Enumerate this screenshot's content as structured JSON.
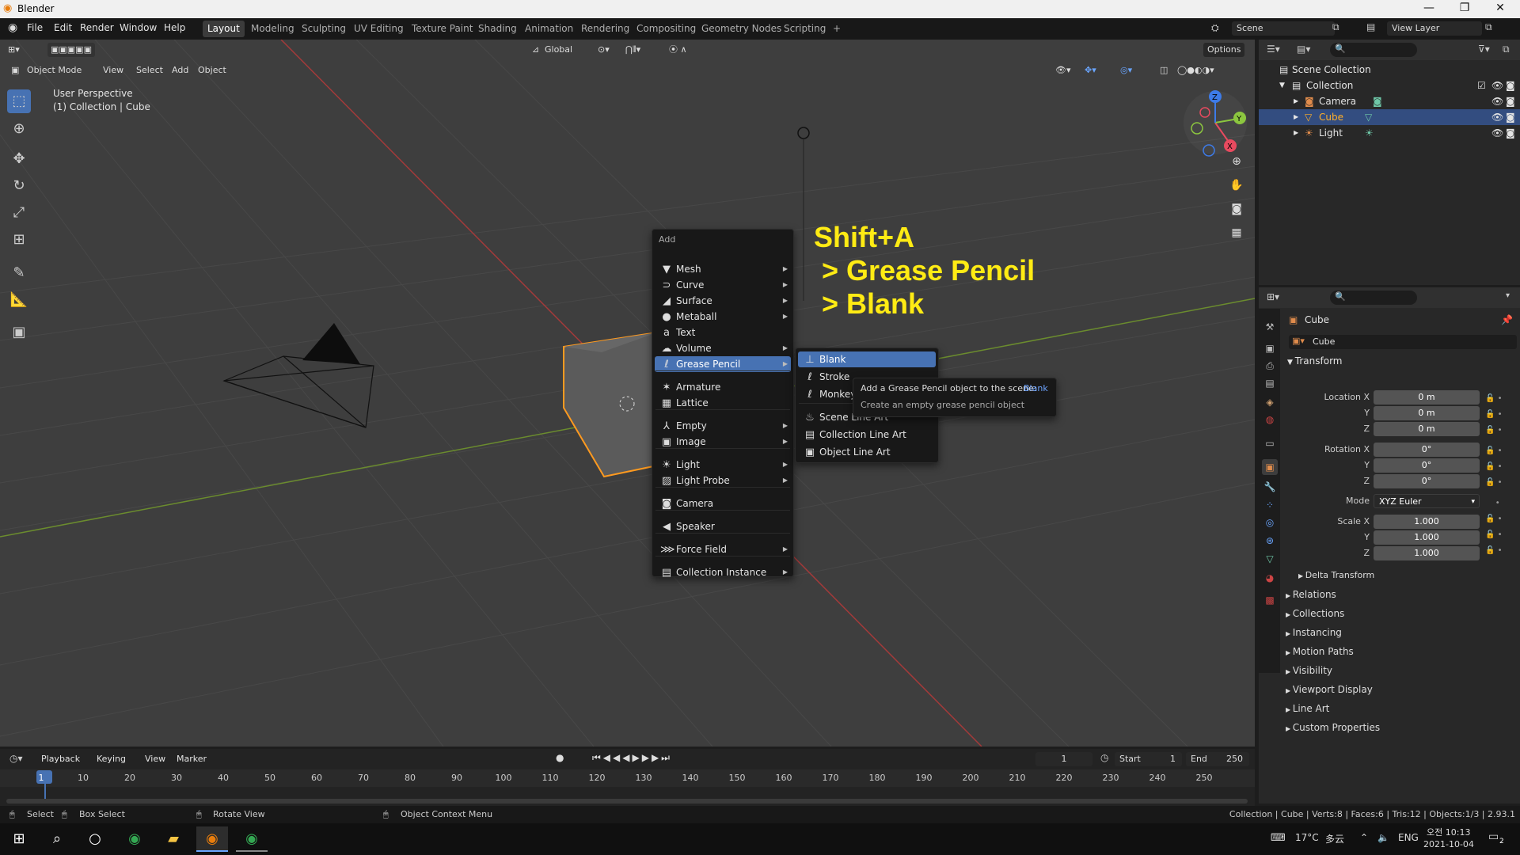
{
  "window": {
    "title": "Blender",
    "minimize": "—",
    "restore": "❐",
    "close": "✕"
  },
  "menubar": [
    "File",
    "Edit",
    "Render",
    "Window",
    "Help"
  ],
  "workspaces": [
    "Layout",
    "Modeling",
    "Sculpting",
    "UV Editing",
    "Texture Paint",
    "Shading",
    "Animation",
    "Rendering",
    "Compositing",
    "Geometry Nodes",
    "Scripting"
  ],
  "workspace_add": "+",
  "scene": {
    "name": "Scene",
    "view_layer": "View Layer"
  },
  "header": {
    "orientation": "Global",
    "options": "Options"
  },
  "viewport_header": {
    "mode": "Object Mode",
    "menus": [
      "View",
      "Select",
      "Add",
      "Object"
    ]
  },
  "viewport": {
    "perspective": "User Perspective",
    "collection": "(1) Collection | Cube"
  },
  "gizmo": {
    "x": "X",
    "y": "Y",
    "z": "Z"
  },
  "annotation": {
    "line1": "Shift+A",
    "line2": "> Grease Pencil",
    "line3": "> Blank"
  },
  "add_menu": {
    "title": "Add",
    "items": [
      {
        "label": "Mesh",
        "icon": "mesh-icon",
        "glyph": "▼",
        "submenu": true
      },
      {
        "label": "Curve",
        "icon": "curve-icon",
        "glyph": "⊃",
        "submenu": true
      },
      {
        "label": "Surface",
        "icon": "surface-icon",
        "glyph": "◢",
        "submenu": true
      },
      {
        "label": "Metaball",
        "icon": "metaball-icon",
        "glyph": "●",
        "submenu": true
      },
      {
        "label": "Text",
        "icon": "text-icon",
        "glyph": "a",
        "submenu": false
      },
      {
        "label": "Volume",
        "icon": "volume-icon",
        "glyph": "☁",
        "submenu": true
      },
      {
        "label": "Grease Pencil",
        "icon": "grease-pencil-icon",
        "glyph": "ℓ",
        "submenu": true,
        "active": true
      },
      {
        "label": "Armature",
        "icon": "armature-icon",
        "glyph": "✶",
        "submenu": false
      },
      {
        "label": "Lattice",
        "icon": "lattice-icon",
        "glyph": "▦",
        "submenu": false
      },
      {
        "label": "Empty",
        "icon": "empty-icon",
        "glyph": "⅄",
        "submenu": true
      },
      {
        "label": "Image",
        "icon": "image-icon",
        "glyph": "▣",
        "submenu": true
      },
      {
        "label": "Light",
        "icon": "light-icon",
        "glyph": "☀",
        "submenu": true
      },
      {
        "label": "Light Probe",
        "icon": "light-probe-icon",
        "glyph": "▨",
        "submenu": true
      },
      {
        "label": "Camera",
        "icon": "camera-icon",
        "glyph": "◙",
        "submenu": false
      },
      {
        "label": "Speaker",
        "icon": "speaker-icon",
        "glyph": "◀",
        "submenu": false
      },
      {
        "label": "Force Field",
        "icon": "force-field-icon",
        "glyph": "⋙",
        "submenu": true
      },
      {
        "label": "Collection Instance",
        "icon": "collection-instance-icon",
        "glyph": "▤",
        "submenu": true
      }
    ]
  },
  "gp_submenu": {
    "items": [
      {
        "label": "Blank",
        "icon": "blank-gp-icon",
        "glyph": "⊥"
      },
      {
        "label": "Stroke",
        "icon": "stroke-icon",
        "glyph": "ℓ"
      },
      {
        "label": "Monkey",
        "icon": "monkey-icon",
        "glyph": "ℓ"
      },
      {
        "label": "Scene Line Art",
        "icon": "scene-line-art-icon",
        "glyph": "♨"
      },
      {
        "label": "Collection Line Art",
        "icon": "collection-line-art-icon",
        "glyph": "▤"
      },
      {
        "label": "Object Line Art",
        "icon": "object-line-art-icon",
        "glyph": "▣"
      }
    ]
  },
  "tooltip": {
    "prefix": "Add a Grease Pencil object to the scene:",
    "highlight": "Blank",
    "description": "Create an empty grease pencil object"
  },
  "outliner": {
    "root": "Scene Collection",
    "collection": "Collection",
    "objects": [
      "Camera",
      "Cube",
      "Light"
    ]
  },
  "properties": {
    "object_name": "Cube",
    "datablock": "Cube",
    "transform_title": "Transform",
    "location_label": "Location X",
    "rotation_label": "Rotation X",
    "scale_label": "Scale X",
    "y": "Y",
    "z": "Z",
    "location": [
      "0 m",
      "0 m",
      "0 m"
    ],
    "rotation": [
      "0°",
      "0°",
      "0°"
    ],
    "mode_label": "Mode",
    "mode": "XYZ Euler",
    "scale": [
      "1.000",
      "1.000",
      "1.000"
    ],
    "delta": "Delta Transform",
    "sections": [
      "Relations",
      "Collections",
      "Instancing",
      "Motion Paths",
      "Visibility",
      "Viewport Display",
      "Line Art",
      "Custom Properties"
    ]
  },
  "timeline": {
    "menus": [
      "Playback",
      "Keying",
      "View",
      "Marker"
    ],
    "current_frame": "1",
    "start_label": "Start",
    "start": "1",
    "end_label": "End",
    "end": "250",
    "ticks": [
      "1",
      "10",
      "20",
      "30",
      "40",
      "50",
      "60",
      "70",
      "80",
      "90",
      "100",
      "110",
      "120",
      "130",
      "140",
      "150",
      "160",
      "170",
      "180",
      "190",
      "200",
      "210",
      "220",
      "230",
      "240",
      "250"
    ]
  },
  "statusbar": {
    "select": "Select",
    "box_select": "Box Select",
    "rotate": "Rotate View",
    "context": "Object Context Menu",
    "stats": "Collection | Cube | Verts:8 | Faces:6 | Tris:12 | Objects:1/3 | 2.93.1"
  },
  "taskbar": {
    "temperature": "17°C",
    "weather": "多云",
    "language": "ENG",
    "time": "오전 10:13",
    "date": "2021-10-04",
    "notifications": "2"
  },
  "colors": {
    "accent": "#4772b3",
    "annotation": "#ffeb14",
    "selection": "#ff9a1f"
  }
}
